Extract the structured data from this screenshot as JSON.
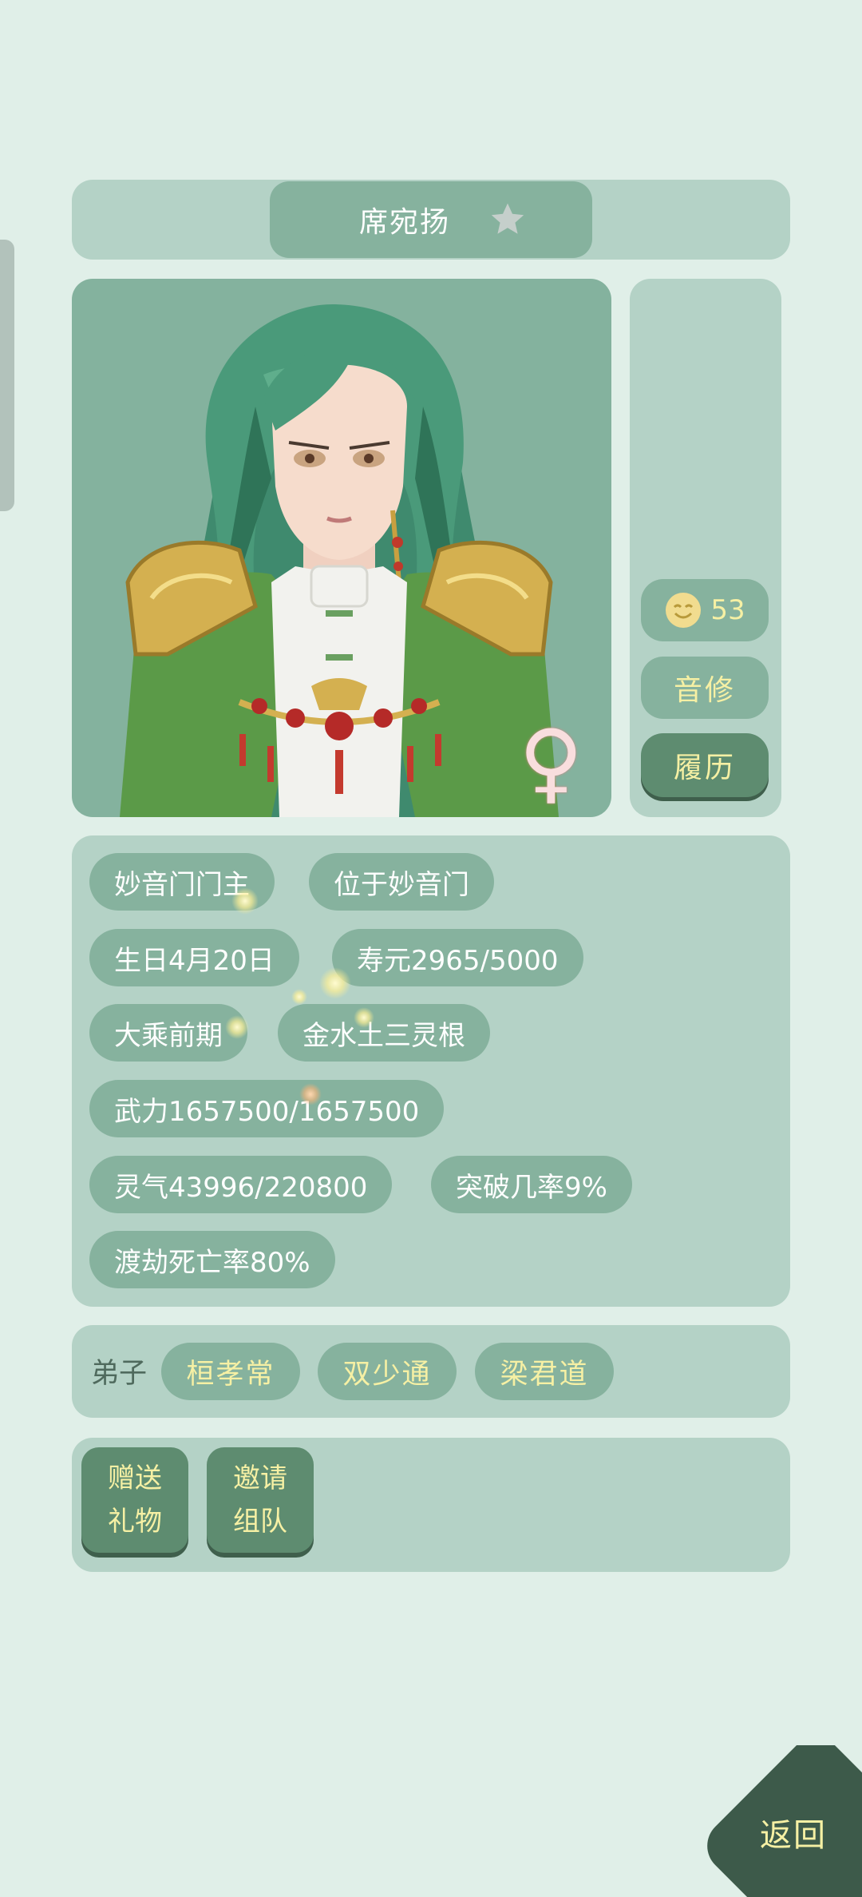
{
  "character": {
    "name": "席宛扬",
    "gender_symbol": "♀",
    "mood": "53",
    "sect_type": "音修",
    "history_button": "履历"
  },
  "stats": [
    "妙音门门主",
    "位于妙音门",
    "生日4月20日",
    "寿元2965/5000",
    "大乘前期",
    "金水土三灵根",
    "武力1657500/1657500",
    "灵气43996/220800",
    "突破几率9%",
    "渡劫死亡率80%"
  ],
  "disciples": {
    "label": "弟子",
    "names": [
      "桓孝常",
      "双少通",
      "梁君道"
    ]
  },
  "actions": {
    "gift_line1": "赠送",
    "gift_line2": "礼物",
    "invite_line1": "邀请",
    "invite_line2": "组队"
  },
  "back_label": "返回",
  "colors": {
    "background": "#e0efe8",
    "panel": "#b4d2c6",
    "pill": "#86b29e",
    "dark_button": "#5e8c70",
    "accent_text": "#f6f0a4",
    "back_button": "#3d5a4a"
  }
}
